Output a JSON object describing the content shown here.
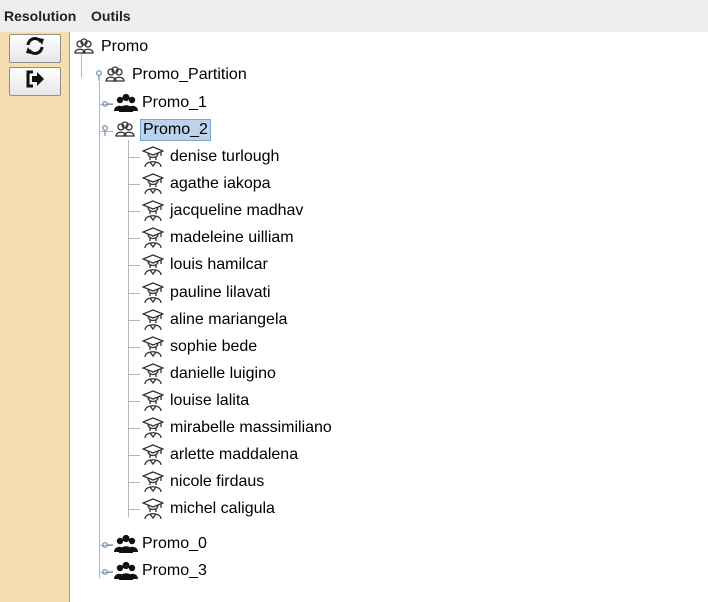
{
  "menubar": {
    "items": [
      {
        "label": "Resolution"
      },
      {
        "label": "Outils"
      }
    ]
  },
  "toolbar": {
    "buttons": [
      {
        "icon": "refresh-icon"
      },
      {
        "icon": "exit-icon"
      }
    ]
  },
  "tree": {
    "root": {
      "label": "Promo",
      "icon": "group-outline-icon"
    },
    "partition": {
      "label": "Promo_Partition",
      "icon": "group-outline-icon"
    },
    "groups": [
      {
        "label": "Promo_1",
        "icon": "group-filled-icon",
        "expanded": false
      },
      {
        "label": "Promo_2",
        "icon": "group-outline-icon",
        "expanded": true,
        "selected": true
      },
      {
        "label": "Promo_0",
        "icon": "group-filled-icon",
        "expanded": false
      },
      {
        "label": "Promo_3",
        "icon": "group-filled-icon",
        "expanded": false
      }
    ],
    "students": [
      {
        "label": "denise turlough"
      },
      {
        "label": "agathe iakopa"
      },
      {
        "label": "jacqueline madhav"
      },
      {
        "label": "madeleine uilliam"
      },
      {
        "label": "louis hamilcar"
      },
      {
        "label": "pauline lilavati"
      },
      {
        "label": "aline mariangela"
      },
      {
        "label": "sophie bede"
      },
      {
        "label": "danielle luigino"
      },
      {
        "label": "louise lalita"
      },
      {
        "label": "mirabelle massimiliano"
      },
      {
        "label": "arlette maddalena"
      },
      {
        "label": "nicole firdaus"
      },
      {
        "label": "michel caligula"
      }
    ]
  },
  "colors": {
    "toolbar_bg": "#f5deb0",
    "selection_bg": "#bcd3ee",
    "menubar_bg": "#eeeeee"
  }
}
